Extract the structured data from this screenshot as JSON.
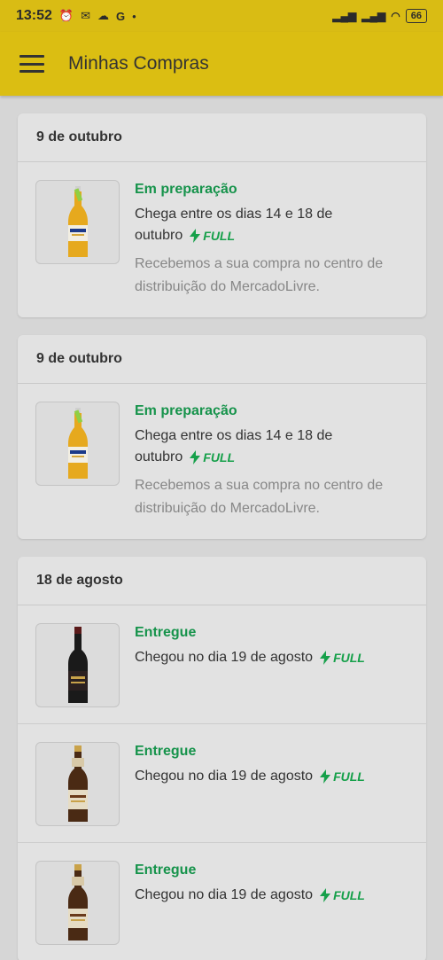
{
  "status_bar": {
    "time": "13:52",
    "icons": [
      "alarm-icon",
      "mail-icon",
      "photo-icon",
      "g-icon",
      "dot-icon"
    ],
    "battery": "66"
  },
  "app_bar": {
    "title": "Minhas Compras",
    "menu_icon": "hamburger-icon"
  },
  "badge": {
    "label": "FULL",
    "color": "#16a04a"
  },
  "accent_colors": {
    "status_green": "#16934b",
    "appbar_yellow": "#dbbe12"
  },
  "orders": [
    {
      "date": "9 de outubro",
      "items": [
        {
          "product": "beer-clear",
          "status": "Em preparação",
          "eta_line1": "Chega entre os dias 14 e 18 de",
          "eta_line2": "outubro",
          "full": true,
          "note_line1": "Recebemos a sua compra no centro de",
          "note_line2": "distribuição do MercadoLivre."
        }
      ]
    },
    {
      "date": "9 de outubro",
      "items": [
        {
          "product": "beer-clear",
          "status": "Em preparação",
          "eta_line1": "Chega entre os dias 14 e 18 de",
          "eta_line2": "outubro",
          "full": true,
          "note_line1": "Recebemos a sua compra no centro de",
          "note_line2": "distribuição do MercadoLivre."
        }
      ]
    },
    {
      "date": "18 de agosto",
      "items": [
        {
          "product": "wine",
          "status": "Entregue",
          "eta_line1": "Chegou no dia 19 de agosto",
          "full": true
        },
        {
          "product": "beer-amber",
          "status": "Entregue",
          "eta_line1": "Chegou no dia 19 de agosto",
          "full": true
        },
        {
          "product": "beer-amber",
          "status": "Entregue",
          "eta_line1": "Chegou no dia 19 de agosto",
          "full": true
        }
      ]
    }
  ]
}
